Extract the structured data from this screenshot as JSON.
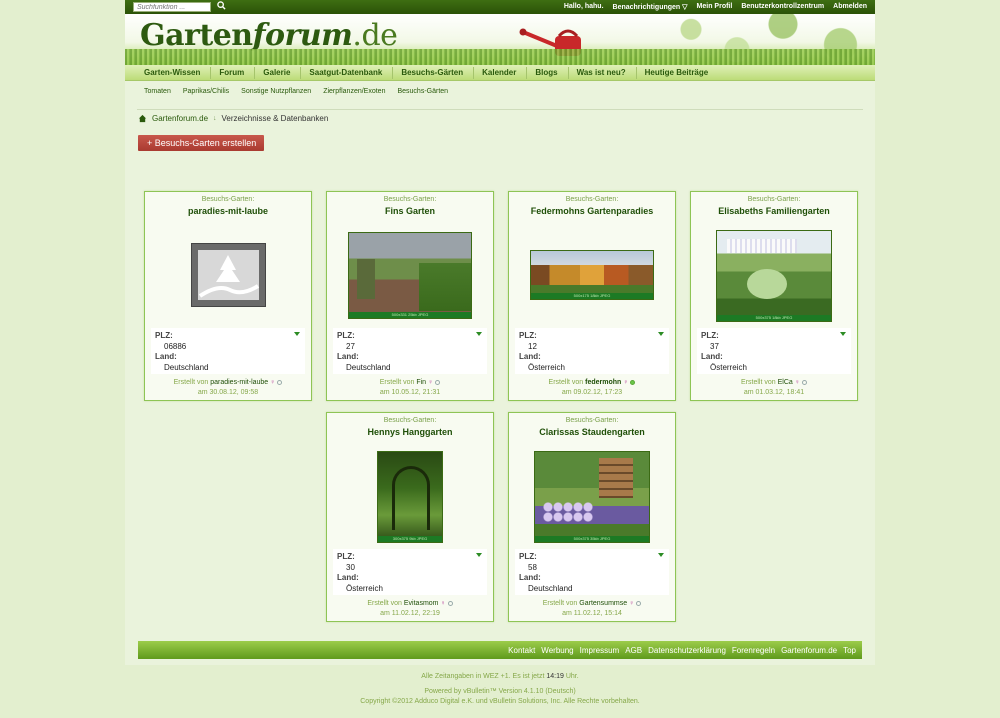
{
  "search": {
    "placeholder": "Suchfunktion ..."
  },
  "usernav": [
    "Hallo, hahu.",
    "Benachrichtigungen ▽",
    "Mein Profil",
    "Benutzerkontrollzentrum",
    "Abmelden"
  ],
  "logo": {
    "part1": "Garten",
    "part2": "forum",
    "part3": ".de"
  },
  "mainnav": [
    "Garten-Wissen",
    "Forum",
    "Galerie",
    "Saatgut-Datenbank",
    "Besuchs-Gärten",
    "Kalender",
    "Blogs",
    "Was ist neu?",
    "Heutige Beiträge"
  ],
  "subnav": [
    "Tomaten",
    "Paprikas/Chilis",
    "Sonstige Nutzpflanzen",
    "Zierpflanzen/Exoten",
    "Besuchs-Gärten"
  ],
  "breadcrumb": {
    "home": "Gartenforum.de",
    "current": "Verzeichnisse & Datenbanken"
  },
  "create_button": "+ Besuchs-Garten erstellen",
  "labels": {
    "kicker": "Besuchs-Garten:",
    "plz": "PLZ:",
    "land": "Land:",
    "created_by": "Erstellt von",
    "on": "am"
  },
  "cards": [
    {
      "title": "paradies-mit-laube",
      "plz": "06886",
      "land": "Deutschland",
      "user": "paradies-mit-laube",
      "date": "30.08.12, 09:58",
      "caption": "",
      "online": false
    },
    {
      "title": "Fins Garten",
      "plz": "27",
      "land": "Deutschland",
      "user": "Fin",
      "date": "10.05.12, 21:31",
      "caption": "500x331 25kb JPEG",
      "online": false
    },
    {
      "title": "Federmohns Gartenparadies",
      "plz": "12",
      "land": "Österreich",
      "user": "federmohn",
      "date": "09.02.12, 17:23",
      "caption": "500x175 18kb JPEG",
      "online": true
    },
    {
      "title": "Elisabeths Familiengarten",
      "plz": "37",
      "land": "Österreich",
      "user": "ElCa",
      "date": "01.03.12, 18:41",
      "caption": "500x375 18kb JPEG",
      "online": false
    },
    {
      "title": "Hennys Hanggarten",
      "plz": "30",
      "land": "Österreich",
      "user": "Evitasmom",
      "date": "11.02.12, 22:19",
      "caption": "300x375 9kb JPEG",
      "online": false
    },
    {
      "title": "Clarissas Staudengarten",
      "plz": "58",
      "land": "Deutschland",
      "user": "Gartensummse",
      "date": "11.02.12, 15:14",
      "caption": "500x375 35kb JPEG",
      "online": false
    }
  ],
  "footer_links": [
    "Kontakt",
    "Werbung",
    "Impressum",
    "AGB",
    "Datenschutzerklärung",
    "Forenregeln",
    "Gartenforum.de",
    "Top"
  ],
  "bottom": {
    "tz_prefix": "Alle Zeitangaben in WEZ +1. Es ist jetzt",
    "time": "14:19",
    "tz_suffix": "Uhr.",
    "powered": "Powered by vBulletin™ Version 4.1.10 (Deutsch)",
    "copyright": "Copyright ©2012 Adduco Digital e.K. und vBulletin Solutions, Inc. Alle Rechte vorbehalten."
  }
}
